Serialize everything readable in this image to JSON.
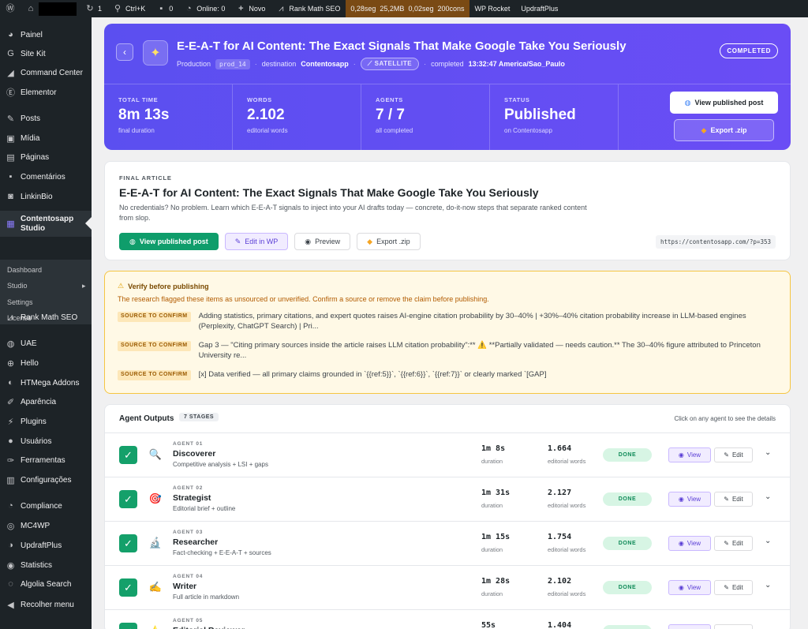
{
  "adminbar": {
    "updates_count": "1",
    "search_label": "Ctrl+K",
    "comments_count": "0",
    "online_label": "Online: 0",
    "new_label": "Novo",
    "rankmath_label": "Rank Math SEO",
    "perf": [
      "0,28seg",
      "25,2MB",
      "0,02seg",
      "200cons"
    ],
    "wprocket_label": "WP Rocket",
    "updraft_label": "UpdraftPlus"
  },
  "sidebar": {
    "items": [
      {
        "label": "Painel",
        "icon": "dashboard-icon"
      },
      {
        "label": "Site Kit",
        "icon": "sitekit-icon"
      },
      {
        "label": "Command Center",
        "icon": "command-icon"
      },
      {
        "label": "Elementor",
        "icon": "elementor-icon"
      },
      {
        "label": "Posts",
        "icon": "pin-icon"
      },
      {
        "label": "Mídia",
        "icon": "media-icon"
      },
      {
        "label": "Páginas",
        "icon": "pages-icon"
      },
      {
        "label": "Comentários",
        "icon": "comment-icon"
      },
      {
        "label": "LinkinBio",
        "icon": "instagram-icon"
      },
      {
        "label": "Contentosapp Studio",
        "icon": "grid-icon"
      },
      {
        "label": "Rank Math SEO",
        "icon": "rankmath-icon"
      },
      {
        "label": "UAE",
        "icon": "uae-icon"
      },
      {
        "label": "Hello",
        "icon": "plus-icon"
      },
      {
        "label": "HTMega Addons",
        "icon": "htmega-icon"
      },
      {
        "label": "Aparência",
        "icon": "brush-icon"
      },
      {
        "label": "Plugins",
        "icon": "plugin-icon"
      },
      {
        "label": "Usuários",
        "icon": "user-icon"
      },
      {
        "label": "Ferramentas",
        "icon": "wrench-icon"
      },
      {
        "label": "Configurações",
        "icon": "settings-icon"
      },
      {
        "label": "Compliance",
        "icon": "compliance-icon"
      },
      {
        "label": "MC4WP",
        "icon": "mc4wp-icon"
      },
      {
        "label": "UpdraftPlus",
        "icon": "updraft-icon"
      },
      {
        "label": "Statistics",
        "icon": "statistics-icon"
      },
      {
        "label": "Algolia Search",
        "icon": "algolia-icon"
      },
      {
        "label": "Recolher menu",
        "icon": "collapse-icon"
      }
    ],
    "submenu": [
      "Dashboard",
      "Studio",
      "Settings",
      "License"
    ]
  },
  "hero": {
    "back_icon": "chevron-left-icon",
    "title": "E-E-A-T for AI Content: The Exact Signals That Make Google Take You Seriously",
    "env_label": "Production",
    "env_id": "prod_14",
    "destination_label": "destination",
    "destination_value": "Contentosapp",
    "satellite_label": "SATELLITE",
    "completed_label": "completed",
    "completed_value": "13:32:47 America/Sao_Paulo",
    "status_badge": "COMPLETED",
    "stats": [
      {
        "label": "TOTAL TIME",
        "value": "8m 13s",
        "sub": "final duration"
      },
      {
        "label": "WORDS",
        "value": "2.102",
        "sub": "editorial words"
      },
      {
        "label": "AGENTS",
        "value": "7 / 7",
        "sub": "all completed"
      },
      {
        "label": "STATUS",
        "value": "Published",
        "sub": "on Contentosapp"
      }
    ],
    "view_published": "View published post",
    "export_zip": "Export .zip"
  },
  "final_article": {
    "label": "FINAL ARTICLE",
    "title": "E-E-A-T for AI Content: The Exact Signals That Make Google Take You Seriously",
    "description": "No credentials? No problem. Learn which E-E-A-T signals to inject into your AI drafts today — concrete, do-it-now steps that separate ranked content from slop.",
    "buttons": {
      "view": "View published post",
      "edit": "Edit in WP",
      "preview": "Preview",
      "export": "Export .zip"
    },
    "url": "https://contentosapp.com/?p=353"
  },
  "verify": {
    "title": "Verify before publishing",
    "subtitle": "The research flagged these items as unsourced or unverified. Confirm a source or remove the claim before publishing.",
    "tag": "SOURCE TO CONFIRM",
    "items": [
      "Adding statistics, primary citations, and expert quotes raises AI-engine citation probability by 30–40% | +30%–40% citation probability increase in LLM-based engines (Perplexity, ChatGPT Search) | Pri...",
      "Gap 3 — \"Citing primary sources inside the article raises LLM citation probability\":** ⚠️ **Partially validated — needs caution.** The 30–40% figure attributed to Princeton University re...",
      "[x] Data verified — all primary claims grounded in `{{ref:5}}`, `{{ref:6}}`, `{{ref:7}}` or clearly marked `[GAP]"
    ]
  },
  "agents": {
    "title": "Agent Outputs",
    "stages": "7 STAGES",
    "hint": "Click on any agent to see the details",
    "duration_label": "duration",
    "words_label": "editorial words",
    "done_label": "DONE",
    "view_label": "View",
    "edit_label": "Edit",
    "rows": [
      {
        "num": "AGENT 01",
        "name": "Discoverer",
        "desc": "Competitive analysis + LSI + gaps",
        "emoji": "🔍",
        "duration": "1m 8s",
        "words": "1.664"
      },
      {
        "num": "AGENT 02",
        "name": "Strategist",
        "desc": "Editorial brief + outline",
        "emoji": "🎯",
        "duration": "1m 31s",
        "words": "2.127"
      },
      {
        "num": "AGENT 03",
        "name": "Researcher",
        "desc": "Fact-checking + E-E-A-T + sources",
        "emoji": "🔬",
        "duration": "1m 15s",
        "words": "1.754"
      },
      {
        "num": "AGENT 04",
        "name": "Writer",
        "desc": "Full article in markdown",
        "emoji": "✍️",
        "duration": "1m 28s",
        "words": "2.102"
      },
      {
        "num": "AGENT 05",
        "name": "Editorial Reviewer",
        "desc": "",
        "emoji": "⭐",
        "duration": "55s",
        "words": "1.404"
      }
    ]
  }
}
